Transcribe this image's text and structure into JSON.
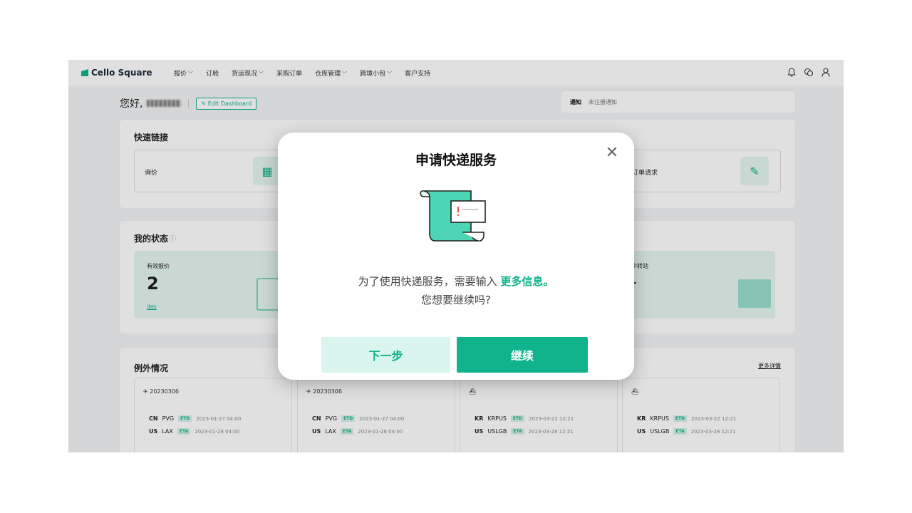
{
  "header": {
    "logo": "Cello Square",
    "nav": [
      {
        "label": "报价",
        "dropdown": true
      },
      {
        "label": "订舱",
        "dropdown": false
      },
      {
        "label": "货运现况",
        "dropdown": true
      },
      {
        "label": "采购订单",
        "dropdown": false
      },
      {
        "label": "仓库管理",
        "dropdown": true
      },
      {
        "label": "跨境小包",
        "dropdown": true
      },
      {
        "label": "客户支持",
        "dropdown": false
      }
    ],
    "icons": [
      "bell-icon",
      "chat-icon",
      "user-icon"
    ]
  },
  "greeting": {
    "text": "您好,",
    "edit_button": "Edit Dashboard"
  },
  "notice": {
    "label": "通知",
    "text": "未注册通知"
  },
  "quick_links": {
    "title": "快速链接",
    "items": [
      {
        "label": "询价",
        "icon": "calculator-icon"
      },
      {
        "label": "订单请求",
        "icon": "document-edit-icon"
      }
    ]
  },
  "my_status": {
    "title": "我的状态",
    "boxes": [
      {
        "label": "有效报价",
        "value": "2",
        "link": "询价"
      },
      {
        "label": "中转站",
        "value": "-"
      }
    ]
  },
  "exceptions": {
    "title": "例外情况",
    "more": "更多详情",
    "cards": [
      {
        "title": "20230306",
        "mode": "air",
        "from_country": "CN",
        "from_port": "PVG",
        "etd": "2023-01-27 04:00",
        "to_country": "US",
        "to_port": "LAX",
        "eta": "2023-01-28 04:00"
      },
      {
        "title": "20230306",
        "mode": "air",
        "from_country": "CN",
        "from_port": "PVG",
        "etd": "2023-01-27 04:00",
        "to_country": "US",
        "to_port": "LAX",
        "eta": "2023-01-28 04:00"
      },
      {
        "title": "",
        "mode": "ship",
        "from_country": "KR",
        "from_port": "KRPUS",
        "etd": "2023-03-22 12:21",
        "to_country": "US",
        "to_port": "USLGB",
        "eta": "2023-03-28 12:21"
      },
      {
        "title": "",
        "mode": "ship",
        "from_country": "KR",
        "from_port": "KRPUS",
        "etd": "2023-03-22 12:21",
        "to_country": "US",
        "to_port": "USLGB",
        "eta": "2023-03-28 12:21"
      }
    ],
    "etd_tag": "ETD",
    "eta_tag": "ETA"
  },
  "modal": {
    "title": "申请快递服务",
    "message_part1": "为了使用快递服务，需要输入",
    "message_highlight": "更多信息。",
    "message_line2": "您想要继续吗?",
    "next_button": "下一步",
    "continue_button": "继续",
    "accent_color": "#11b38c"
  }
}
